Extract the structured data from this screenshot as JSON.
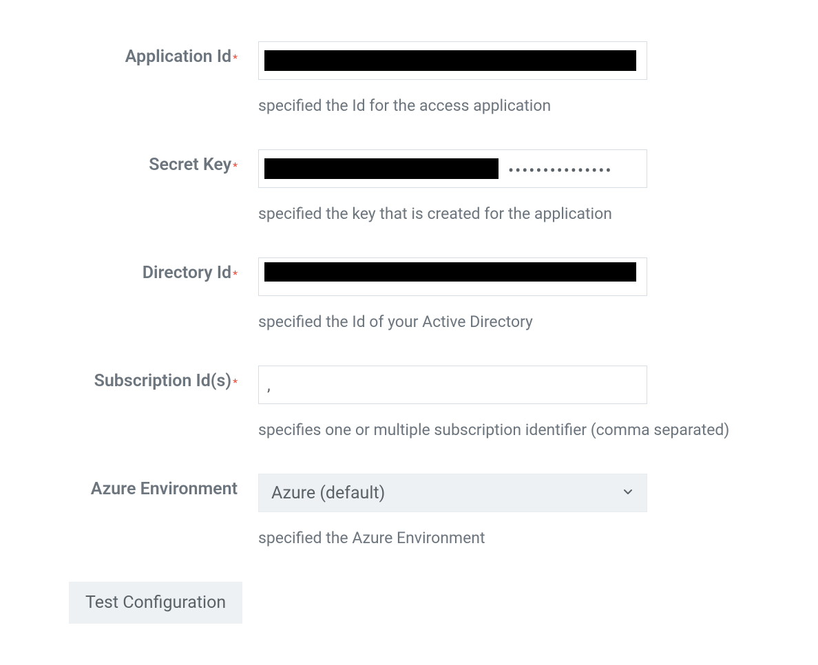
{
  "fields": {
    "applicationId": {
      "label": "Application Id",
      "required": true,
      "help": "specified the Id for the access application",
      "value_redacted": true
    },
    "secretKey": {
      "label": "Secret Key",
      "required": true,
      "help": "specified the key that is created for the application",
      "value_redacted": true,
      "masked_suffix": "•••••••••••••••"
    },
    "directoryId": {
      "label": "Directory Id",
      "required": true,
      "help": "specified the Id of your Active Directory",
      "value_redacted": true
    },
    "subscriptionIds": {
      "label": "Subscription Id(s)",
      "required": true,
      "help": "specifies one or multiple subscription identifier (comma separated)",
      "value": ","
    },
    "azureEnvironment": {
      "label": "Azure Environment",
      "required": false,
      "help": "specified the Azure Environment",
      "selected": "Azure (default)"
    }
  },
  "required_marker": "*",
  "testButton": "Test Configuration"
}
